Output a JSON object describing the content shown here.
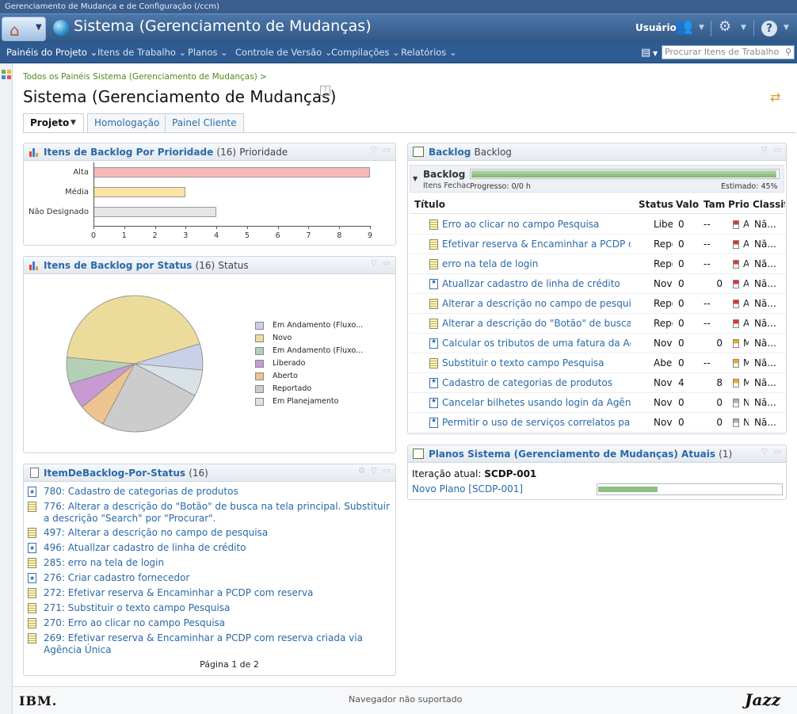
{
  "window_title": "Gerenciamento de Mudança e de Configuração (/ccm)",
  "app_title": "Sistema (Gerenciamento de Mudanças)",
  "header": {
    "user_label": "Usuário"
  },
  "nav": {
    "items": [
      "Painéis do Projeto",
      "Itens de Trabalho",
      "Planos",
      "Controle de Versão",
      "Compilações",
      "Relatórios"
    ],
    "search_placeholder": "Procurar Itens de Trabalho"
  },
  "breadcrumb": "Todos os Painéis Sistema (Gerenciamento de Mudanças) >",
  "page_title": "Sistema (Gerenciamento de Mudanças)",
  "tabs": [
    "Projeto",
    "Homologação",
    "Painel Cliente"
  ],
  "widget_priority": {
    "title": "Itens de Backlog Por Prioridade",
    "count": "(16)",
    "subtitle": "Prioridade",
    "chart_data": {
      "type": "bar",
      "orientation": "horizontal",
      "categories": [
        "Alta",
        "Média",
        "Não Designado"
      ],
      "values": [
        9,
        3,
        4
      ],
      "colors": [
        "#f7b8b8",
        "#fbe3a3",
        "#e6e6e6"
      ],
      "xlim": [
        0,
        9
      ],
      "xticks": [
        "0",
        "1",
        "2",
        "3",
        "4",
        "5",
        "6",
        "7",
        "8",
        "9"
      ]
    }
  },
  "widget_status": {
    "title": "Itens de Backlog por Status",
    "count": "(16)",
    "subtitle": "Status",
    "chart_data": {
      "type": "pie",
      "slices": [
        {
          "label": "Novo",
          "value": 7,
          "color": "#ecdc9c"
        },
        {
          "label": "Em Andamento (Fluxo...",
          "value": 1,
          "color": "#c9d1e8"
        },
        {
          "label": "Em Planejamento",
          "value": 1,
          "color": "#d9e2e6"
        },
        {
          "label": "Reportado",
          "value": 4,
          "color": "#cccccc"
        },
        {
          "label": "Aberto",
          "value": 1,
          "color": "#edc48f"
        },
        {
          "label": "Liberado",
          "value": 1,
          "color": "#c79ad2"
        },
        {
          "label": "Em Andamento (Fluxo...",
          "value": 1,
          "color": "#b5d1b5"
        }
      ],
      "legend": [
        {
          "label": "Em Andamento (Fluxo...",
          "color": "#c9d1e8"
        },
        {
          "label": "Novo",
          "color": "#ecdc9c"
        },
        {
          "label": "Em Andamento (Fluxo...",
          "color": "#b5d1b5"
        },
        {
          "label": "Liberado",
          "color": "#c79ad2"
        },
        {
          "label": "Aberto",
          "color": "#edc48f"
        },
        {
          "label": "Reportado",
          "color": "#cccccc"
        },
        {
          "label": "Em Planejamento",
          "color": "#d9e2e6"
        }
      ],
      "legend_position": "right"
    }
  },
  "widget_list": {
    "title": "ItemDeBacklog-Por-Status",
    "count": "(16)",
    "items": [
      {
        "icon": "story",
        "text": "780: Cadastro de categorias de produtos"
      },
      {
        "icon": "task",
        "text": "776: Alterar a descrição do \"Botão\" de busca na tela principal. Substituir a descrição \"Search\" por \"Procurar\"."
      },
      {
        "icon": "task",
        "text": "497: Alterar a descrição no campo de pesquisa"
      },
      {
        "icon": "story",
        "text": "496: Atuallzar cadastro de linha de crédito"
      },
      {
        "icon": "task",
        "text": "285: erro na tela de login"
      },
      {
        "icon": "story",
        "text": "276: Criar cadastro fornecedor"
      },
      {
        "icon": "task",
        "text": "272: Efetivar reserva & Encaminhar a PCDP com reserva"
      },
      {
        "icon": "task",
        "text": "271: Substituir o texto campo Pesquisa"
      },
      {
        "icon": "task",
        "text": "270: Erro ao clicar no campo Pesquisa"
      },
      {
        "icon": "doc",
        "text": "269: Efetivar reserva & Encaminhar a PCDP com reserva criada via Agência Única"
      }
    ],
    "pagination": "Página 1 de 2"
  },
  "widget_backlog": {
    "title": "Backlog",
    "subtitle": "Backlog",
    "section_label": "Backlog",
    "section_sub": "Itens Fechac",
    "progress_label": "Progresso: 0/0 h",
    "estimate_label": "Estimado: 45%",
    "progress_fraction": 0.99,
    "columns": [
      "Título",
      "Status",
      "Valor",
      "Tam",
      "Prioridade",
      "Classificação"
    ],
    "rows": [
      {
        "icon": "task",
        "title": "Erro ao clicar no campo Pesquisa",
        "status_icon": "check",
        "status": "Liberado",
        "value": "0",
        "size": "--",
        "priority": "A",
        "classification": "Nã..."
      },
      {
        "icon": "task",
        "title": "Efetivar reserva & Encaminhar a PCDP c...",
        "status_icon": "arrow",
        "status": "Reportado",
        "value": "0",
        "size": "--",
        "priority": "A",
        "classification": "Nã..."
      },
      {
        "icon": "task",
        "title": "erro na tela de login",
        "status_icon": "arrow",
        "status": "Reportado",
        "value": "0",
        "size": "--",
        "priority": "A",
        "classification": "Nã..."
      },
      {
        "icon": "story",
        "title": "Atuallzar cadastro de linha de crédito",
        "status_icon": "arrow",
        "status": "Novo",
        "value": "0",
        "size": "0",
        "priority": "A",
        "classification": "Nã..."
      },
      {
        "icon": "task",
        "title": "Alterar a descrição no campo de pesquisa",
        "status_icon": "arrow",
        "status": "Reportado",
        "value": "0",
        "size": "--",
        "priority": "A",
        "classification": "Nã..."
      },
      {
        "icon": "task",
        "title": "Alterar a descrição do \"Botão\" de busca ...",
        "status_icon": "arrow",
        "status": "Reportado",
        "value": "0",
        "size": "--",
        "priority": "A",
        "classification": "Nã..."
      },
      {
        "icon": "story",
        "title": "Calcular os tributos de uma fatura da Ag...",
        "status_icon": "arrow",
        "status": "Novo",
        "value": "0",
        "size": "0",
        "priority": "M",
        "classification": "Nã..."
      },
      {
        "icon": "task",
        "title": "Substituir o texto campo Pesquisa",
        "status_icon": "diamond",
        "status": "Aberto",
        "value": "0",
        "size": "--",
        "priority": "M",
        "classification": "Nã..."
      },
      {
        "icon": "story",
        "title": "Cadastro de categorias de produtos",
        "status_icon": "arrow",
        "status": "Novo",
        "value": "4",
        "size": "8",
        "priority": "M",
        "classification": "Nã..."
      },
      {
        "icon": "story",
        "title": "Cancelar  bilhetes usando login da Agên...",
        "status_icon": "arrow",
        "status": "Novo",
        "value": "0",
        "size": "0",
        "priority": "N",
        "classification": "Nã..."
      },
      {
        "icon": "story",
        "title": "Permitir o uso de serviços correlatos par...",
        "status_icon": "arrow",
        "status": "Novo",
        "value": "0",
        "size": "0",
        "priority": "N",
        "classification": "Nã..."
      }
    ]
  },
  "widget_plans": {
    "title": "Planos Sistema (Gerenciamento de Mudanças) Atuais",
    "count": "(1)",
    "iteration_label": "Iteração atual:",
    "iteration_value": "SCDP-001",
    "plan_link": "Novo Plano [SCDP-001]",
    "plan_progress_fraction": 0.32
  },
  "footer": {
    "ibm": "IBM.",
    "unsupported": "Navegador não suportado",
    "jazz": "Jazz"
  }
}
